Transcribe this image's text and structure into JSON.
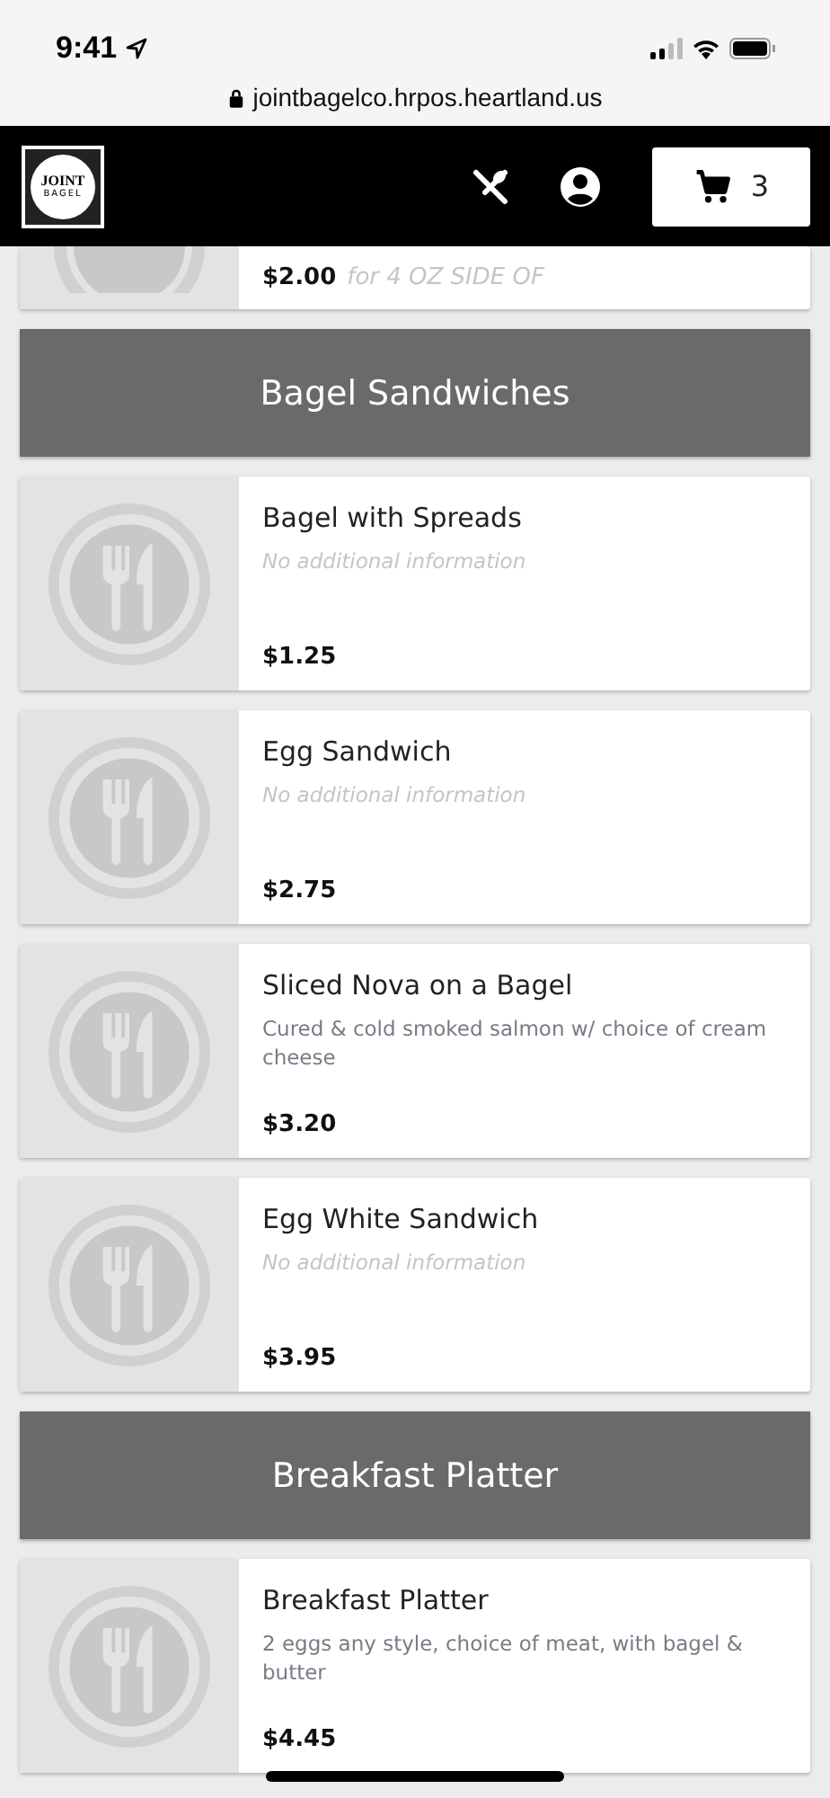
{
  "status_bar": {
    "time": "9:41",
    "url": "jointbagelco.hrpos.heartland.us"
  },
  "header": {
    "logo_lines": [
      "JOINT",
      "BAGEL"
    ],
    "cart_count": "3"
  },
  "partial_item": {
    "price": "$2.00",
    "note": "for 4 OZ SIDE OF"
  },
  "sections": [
    {
      "title": "Bagel Sandwiches",
      "items": [
        {
          "name": "Bagel with Spreads",
          "description": "No additional information",
          "kind": "placeholder",
          "price": "$1.25"
        },
        {
          "name": "Egg Sandwich",
          "description": "No additional information",
          "kind": "placeholder",
          "price": "$2.75"
        },
        {
          "name": "Sliced Nova on a Bagel",
          "description": "Cured & cold smoked salmon w/ choice of cream cheese",
          "kind": "text",
          "price": "$3.20"
        },
        {
          "name": "Egg White Sandwich",
          "description": "No additional information",
          "kind": "placeholder",
          "price": "$3.95"
        }
      ]
    },
    {
      "title": "Breakfast Platter",
      "items": [
        {
          "name": "Breakfast Platter",
          "description": "2 eggs any style, choice of meat, with bagel & butter",
          "kind": "text",
          "price": "$4.45"
        }
      ]
    }
  ]
}
